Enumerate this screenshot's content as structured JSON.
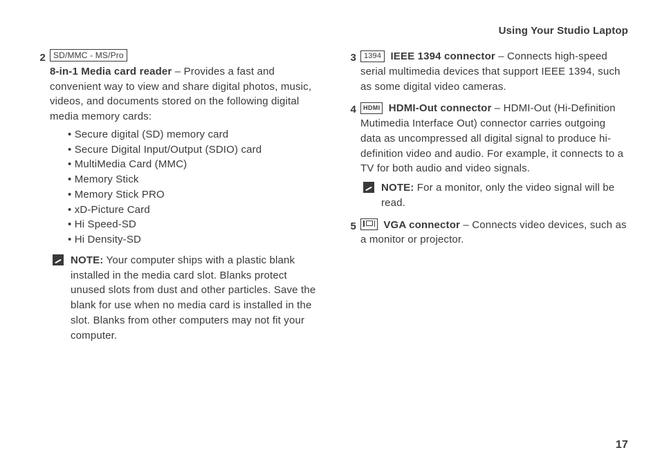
{
  "running_head": "Using Your Studio Laptop",
  "page_number": "17",
  "left": {
    "item2": {
      "num": "2",
      "icon_label": "SD/MMC - MS/Pro",
      "term": "8-in-1 Media card reader",
      "desc": " – Provides a fast and convenient way to view and share digital photos, music, videos, and documents stored on the following digital media memory cards:",
      "bullets": [
        "Secure digital (SD) memory card",
        "Secure Digital Input/Output (SDIO) card",
        "MultiMedia Card (MMC)",
        "Memory Stick",
        "Memory Stick PRO",
        "xD-Picture Card",
        "Hi Speed-SD",
        "Hi Density-SD"
      ],
      "note_label": "NOTE:",
      "note_text": " Your computer ships with a plastic blank installed in the media card slot. Blanks protect unused slots from dust and other particles. Save the blank for use when no media card is installed in the slot. Blanks from other computers may not fit your computer."
    }
  },
  "right": {
    "item3": {
      "num": "3",
      "icon_label": "1394",
      "term": "IEEE 1394 connector",
      "desc": " – Connects high-speed serial multimedia devices that support IEEE 1394, such as some digital video cameras."
    },
    "item4": {
      "num": "4",
      "icon_label": "HDMI",
      "term": "HDMI-Out connector",
      "desc": " – HDMI-Out (Hi-Definition Mutimedia Interface Out) connector carries outgoing data as uncompressed all digital signal to produce hi-definition video and audio. For example, it connects to a TV for both audio and video signals.",
      "note_label": "NOTE:",
      "note_text": " For a monitor, only the video signal will be read."
    },
    "item5": {
      "num": "5",
      "term": "VGA connector",
      "desc": " – Connects video devices, such as a monitor or projector."
    }
  }
}
